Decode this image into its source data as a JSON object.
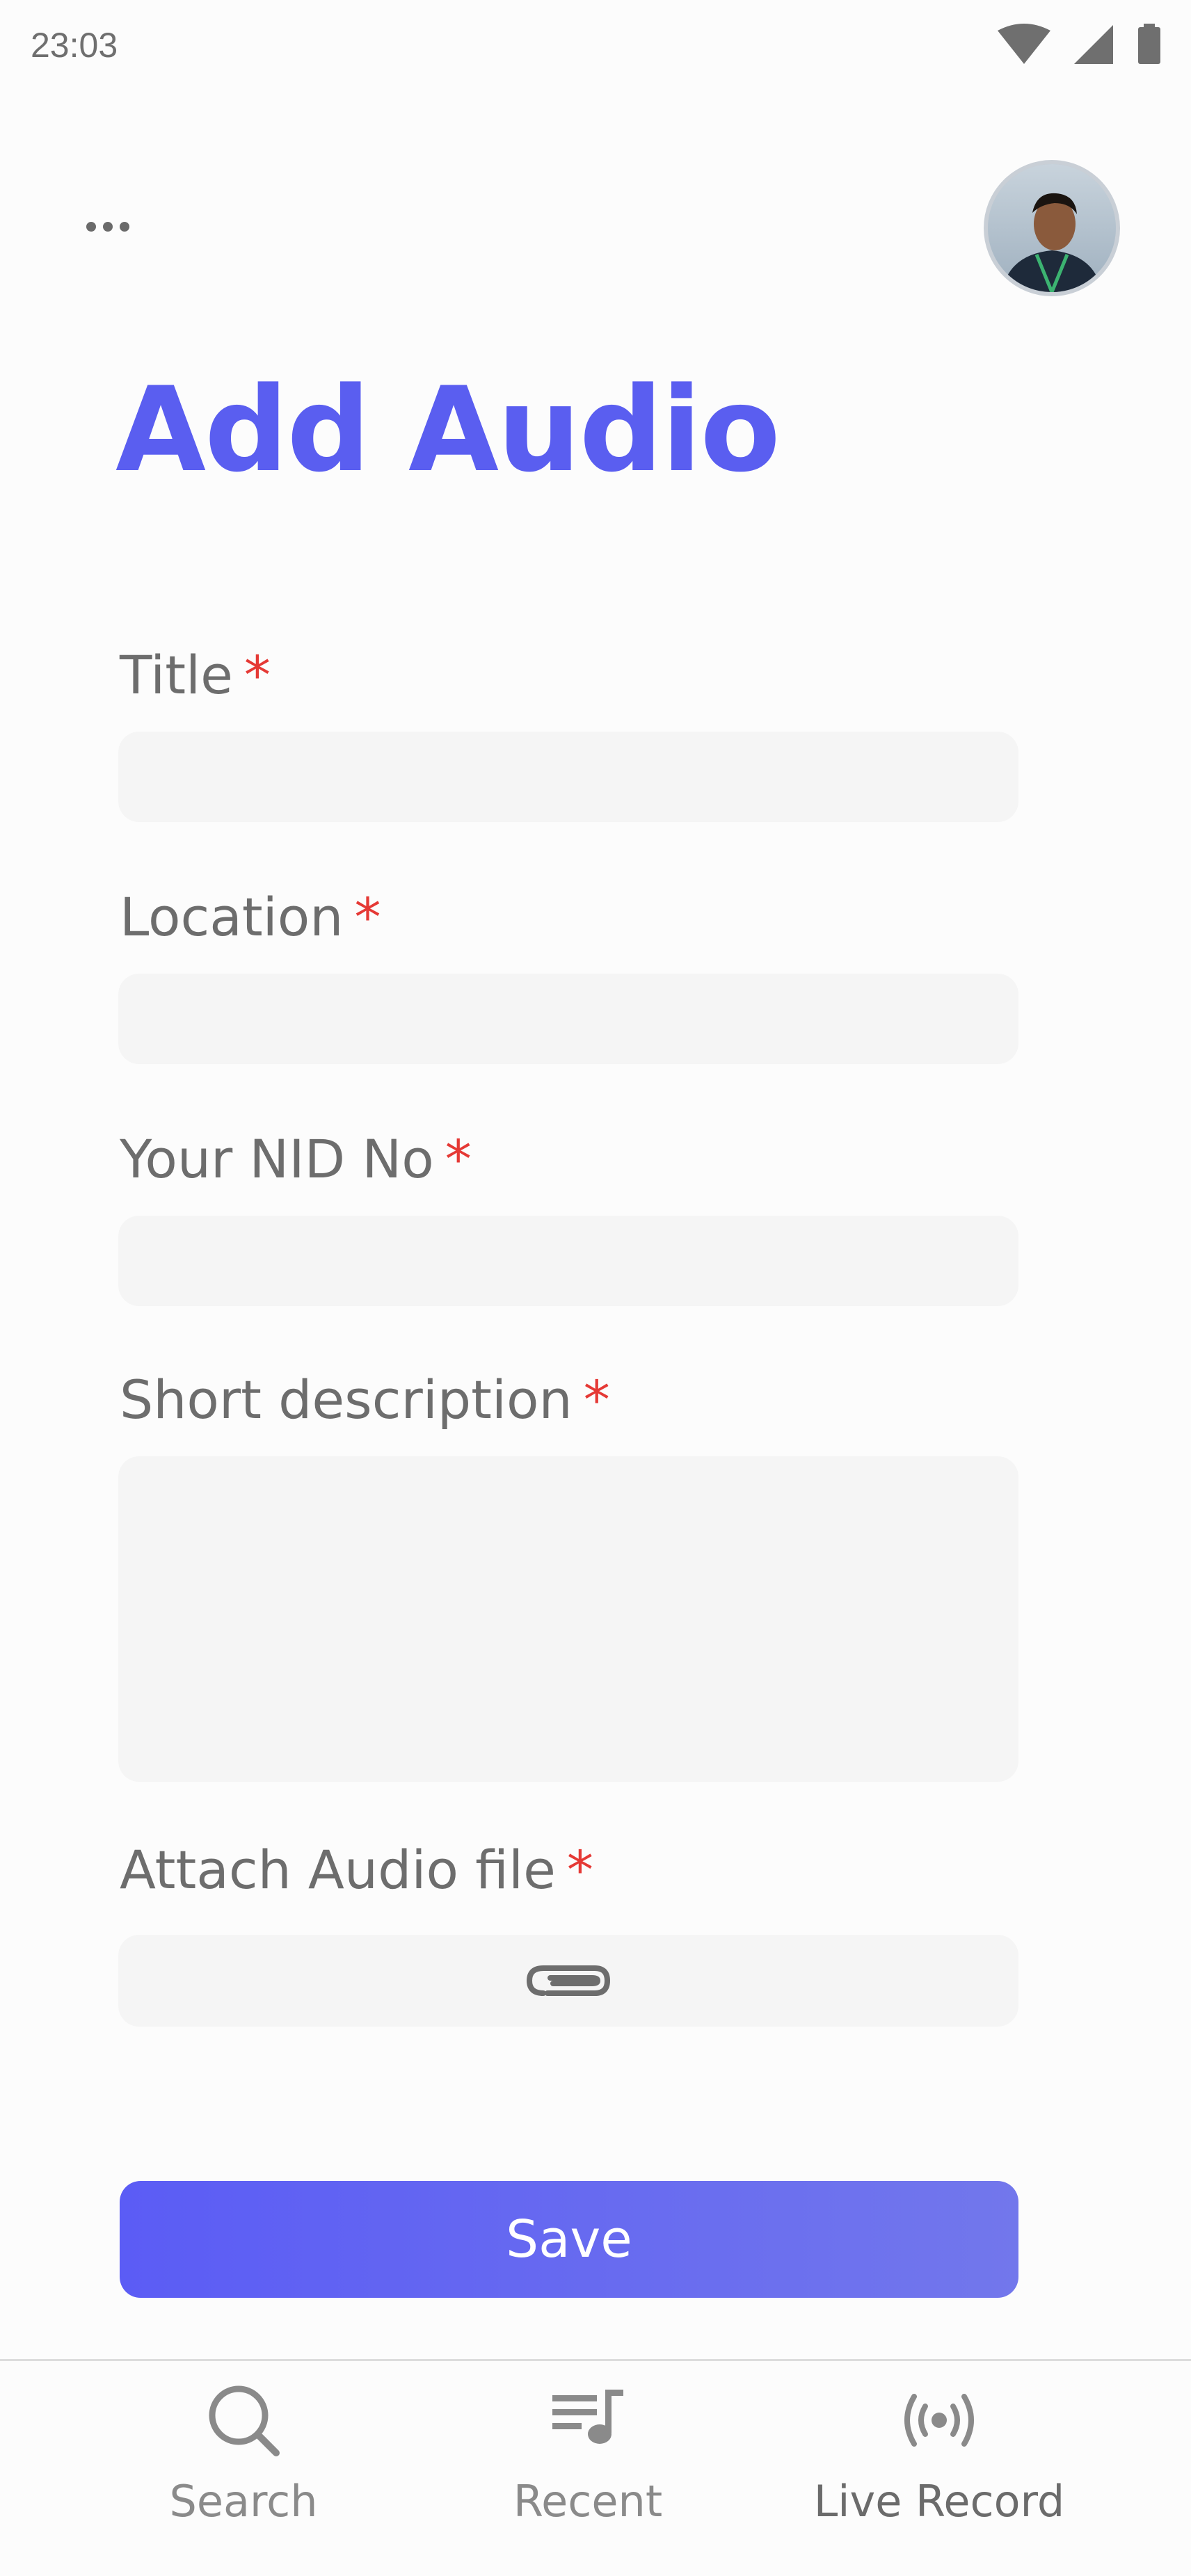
{
  "status_bar": {
    "time": "23:03"
  },
  "header": {
    "more_icon": "more-horizontal-icon",
    "avatar_icon": "profile-avatar"
  },
  "page": {
    "title": "Add Audio"
  },
  "form": {
    "title_label": "Title",
    "location_label": "Location",
    "nid_label": "Your NID No",
    "description_label": "Short description",
    "attach_label": "Attach Audio file",
    "required_marker": "*",
    "title_value": "",
    "location_value": "",
    "nid_value": "",
    "description_value": "",
    "attach_icon": "paperclip-icon",
    "save_label": "Save"
  },
  "bottom_nav": {
    "items": [
      {
        "label": "Search",
        "icon": "search-icon"
      },
      {
        "label": "Recent",
        "icon": "playlist-icon"
      },
      {
        "label": "Live Record",
        "icon": "broadcast-icon"
      }
    ]
  },
  "colors": {
    "accent": "#5a5ef0",
    "required": "#e53935",
    "input_bg": "#f5f5f5"
  }
}
